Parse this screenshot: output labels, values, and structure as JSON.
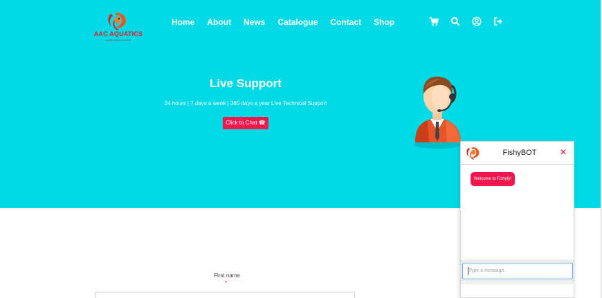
{
  "brand": {
    "name": "AAC AQUATICS",
    "tagline": "aquatic supplies & services"
  },
  "nav": {
    "items": [
      "Home",
      "About",
      "News",
      "Catalogue",
      "Contact",
      "Shop"
    ],
    "icons": [
      "cart-icon",
      "search-icon",
      "user-icon",
      "logout-icon"
    ]
  },
  "hero": {
    "title": "Live Support",
    "subtitle": "24 hours | 7 days a week | 365 days a year    Live Technical Support",
    "chat_button": "Click to Chat ☎",
    "background": "#00d9e6"
  },
  "form": {
    "first_name_label": "First name",
    "required_marker": "*"
  },
  "chatbot": {
    "title": "FishyBOT",
    "close": "✕",
    "welcome_message": "Welcome to Fishyfy!",
    "input_placeholder": "Type a message..",
    "accent": "#f0174f"
  }
}
